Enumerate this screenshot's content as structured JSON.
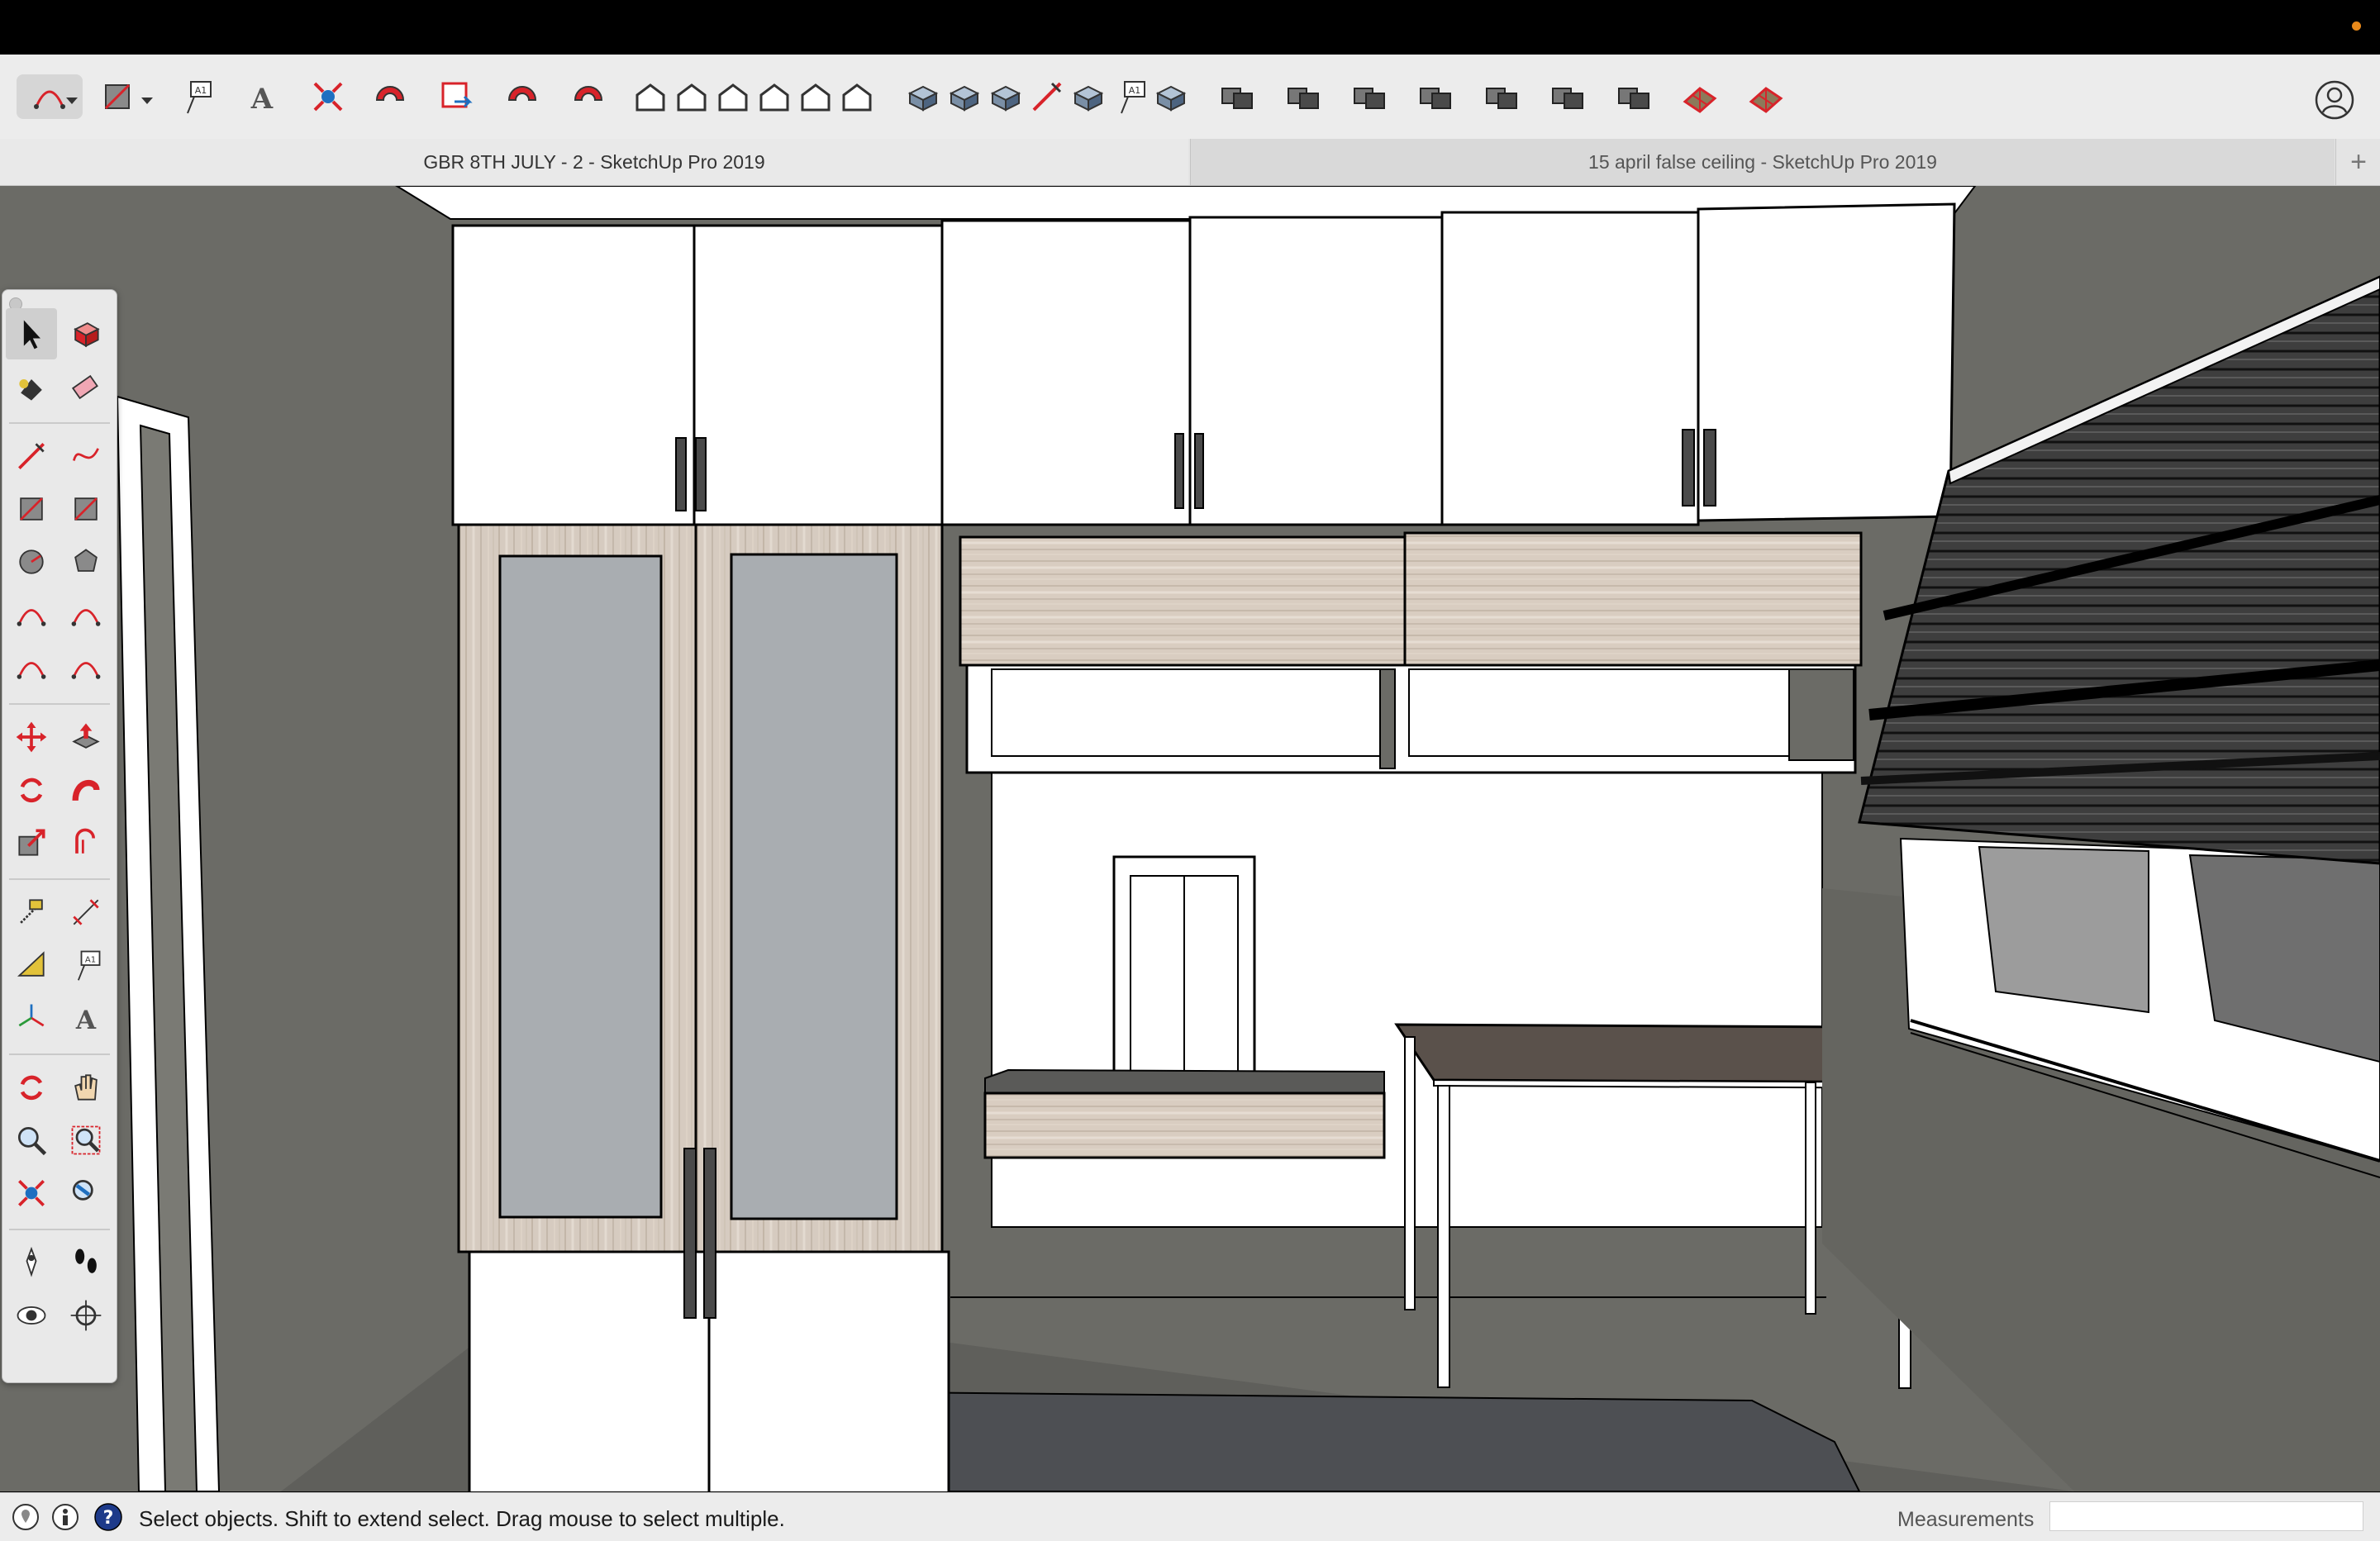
{
  "app": {
    "name": "SketchUp Pro 2019",
    "accent_color": "#e8891a"
  },
  "toolbar": {
    "items": [
      {
        "name": "arc-tool-icon",
        "selected": true,
        "dropdown": true
      },
      {
        "name": "rectangle-tool-icon",
        "dropdown": true
      },
      {
        "name": "text-tool-icon"
      },
      {
        "name": "3d-text-tool-icon"
      },
      {
        "name": "zoom-extents-icon"
      },
      {
        "name": "extension-warehouse-icon"
      },
      {
        "name": "send-to-layout-icon"
      },
      {
        "name": "ruby-console-icon"
      },
      {
        "name": "extension-manager-icon"
      },
      {
        "name": "iso-view-icon"
      },
      {
        "name": "top-view-icon"
      },
      {
        "name": "front-view-icon"
      },
      {
        "name": "right-view-icon"
      },
      {
        "name": "back-view-icon"
      },
      {
        "name": "left-view-icon"
      },
      {
        "name": "xray-style-icon"
      },
      {
        "name": "back-edges-style-icon"
      },
      {
        "name": "wireframe-style-icon"
      },
      {
        "name": "hidden-line-style-icon"
      },
      {
        "name": "shaded-style-icon"
      },
      {
        "name": "shaded-textures-style-icon"
      },
      {
        "name": "monochrome-style-icon"
      },
      {
        "name": "outer-shell-icon"
      },
      {
        "name": "union-icon"
      },
      {
        "name": "subtract-icon"
      },
      {
        "name": "intersect-icon"
      },
      {
        "name": "trim-icon"
      },
      {
        "name": "split-icon"
      },
      {
        "name": "solid-tools-icon"
      },
      {
        "name": "sandbox-from-contours-icon"
      },
      {
        "name": "sandbox-from-scratch-icon"
      }
    ]
  },
  "tabs": [
    {
      "label": "GBR 8TH JULY - 2 - SketchUp Pro 2019",
      "active": true
    },
    {
      "label": "15 april false ceiling - SketchUp Pro 2019",
      "active": false
    }
  ],
  "tab_add_label": "+",
  "palette": {
    "tools": [
      "select-tool-icon",
      "make-component-icon",
      "paint-bucket-icon",
      "eraser-icon",
      "line-tool-icon",
      "freehand-tool-icon",
      "rectangle-tool-icon",
      "rotated-rectangle-icon",
      "circle-tool-icon",
      "polygon-tool-icon",
      "arc-tool-icon",
      "two-point-arc-icon",
      "three-point-arc-icon",
      "pie-tool-icon",
      "move-tool-icon",
      "push-pull-icon",
      "rotate-tool-icon",
      "follow-me-icon",
      "scale-tool-icon",
      "offset-tool-icon",
      "tape-measure-icon",
      "dimension-tool-icon",
      "protractor-icon",
      "text-tool-icon",
      "axes-tool-icon",
      "3d-text-tool-icon",
      "orbit-tool-icon",
      "pan-tool-icon",
      "zoom-tool-icon",
      "zoom-window-icon",
      "zoom-extents-icon",
      "previous-view-icon",
      "position-camera-icon",
      "walk-tool-icon",
      "look-around-icon",
      "section-plane-icon"
    ]
  },
  "status": {
    "message": "Select objects. Shift to extend select. Drag mouse to select multiple.",
    "measurements_label": "Measurements",
    "measurements_value": ""
  }
}
